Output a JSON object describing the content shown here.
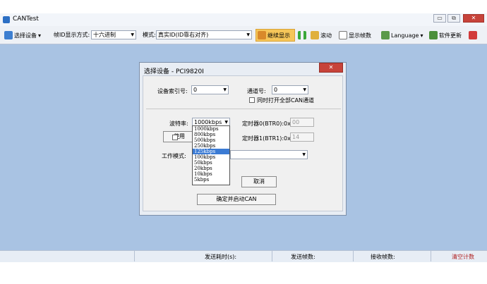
{
  "window": {
    "title": "CANTest",
    "controls": [
      "▭",
      "⧉",
      "✕"
    ]
  },
  "toolbar": {
    "select_device": "选择设备",
    "frame_id_format_label": "帧ID显示方式:",
    "frame_id_format_value": "十六进制",
    "mode_label": "模式:",
    "mode_value": "真实ID(ID靠右对齐)",
    "continue_display": "继续显示",
    "scroll": "滚动",
    "show_frames": "显示帧数",
    "language": "Language",
    "software_update": "软件更新"
  },
  "dialog": {
    "title": "选择设备 - PCI9820I",
    "close": "✕",
    "device_index_label": "设备索引号:",
    "device_index_value": "0",
    "channel_label": "通道号:",
    "channel_value": "0",
    "open_all_label": "同时打开全部CAN通道",
    "baud_label": "波特率:",
    "baud_value": "1000kbps",
    "timer0_label": "定时器0(BTR0):0x",
    "timer0_value": "00",
    "timer1_label": "定时器1(BTR1):0x",
    "timer1_value": "14",
    "use_label": "使用",
    "work_mode_label": "工作模式:",
    "cancel": "取消",
    "confirm_start": "确定并启动CAN",
    "baud_options": [
      "1000kbps",
      "800kbps",
      "500kbps",
      "250kbps",
      "125kbps",
      "100kbps",
      "50kbps",
      "20kbps",
      "10kbps",
      "5kbps"
    ],
    "baud_highlight_index": 4
  },
  "statusbar": {
    "send_time": "发送耗时(s):",
    "send_frames": "发送帧数:",
    "recv_frames": "接收帧数:",
    "clear": "清空计数"
  },
  "colors": {
    "desktop": "#a9c3e3",
    "highlight": "#3b7bd4",
    "close": "#c7433a",
    "accent_button": "#f6c659"
  }
}
